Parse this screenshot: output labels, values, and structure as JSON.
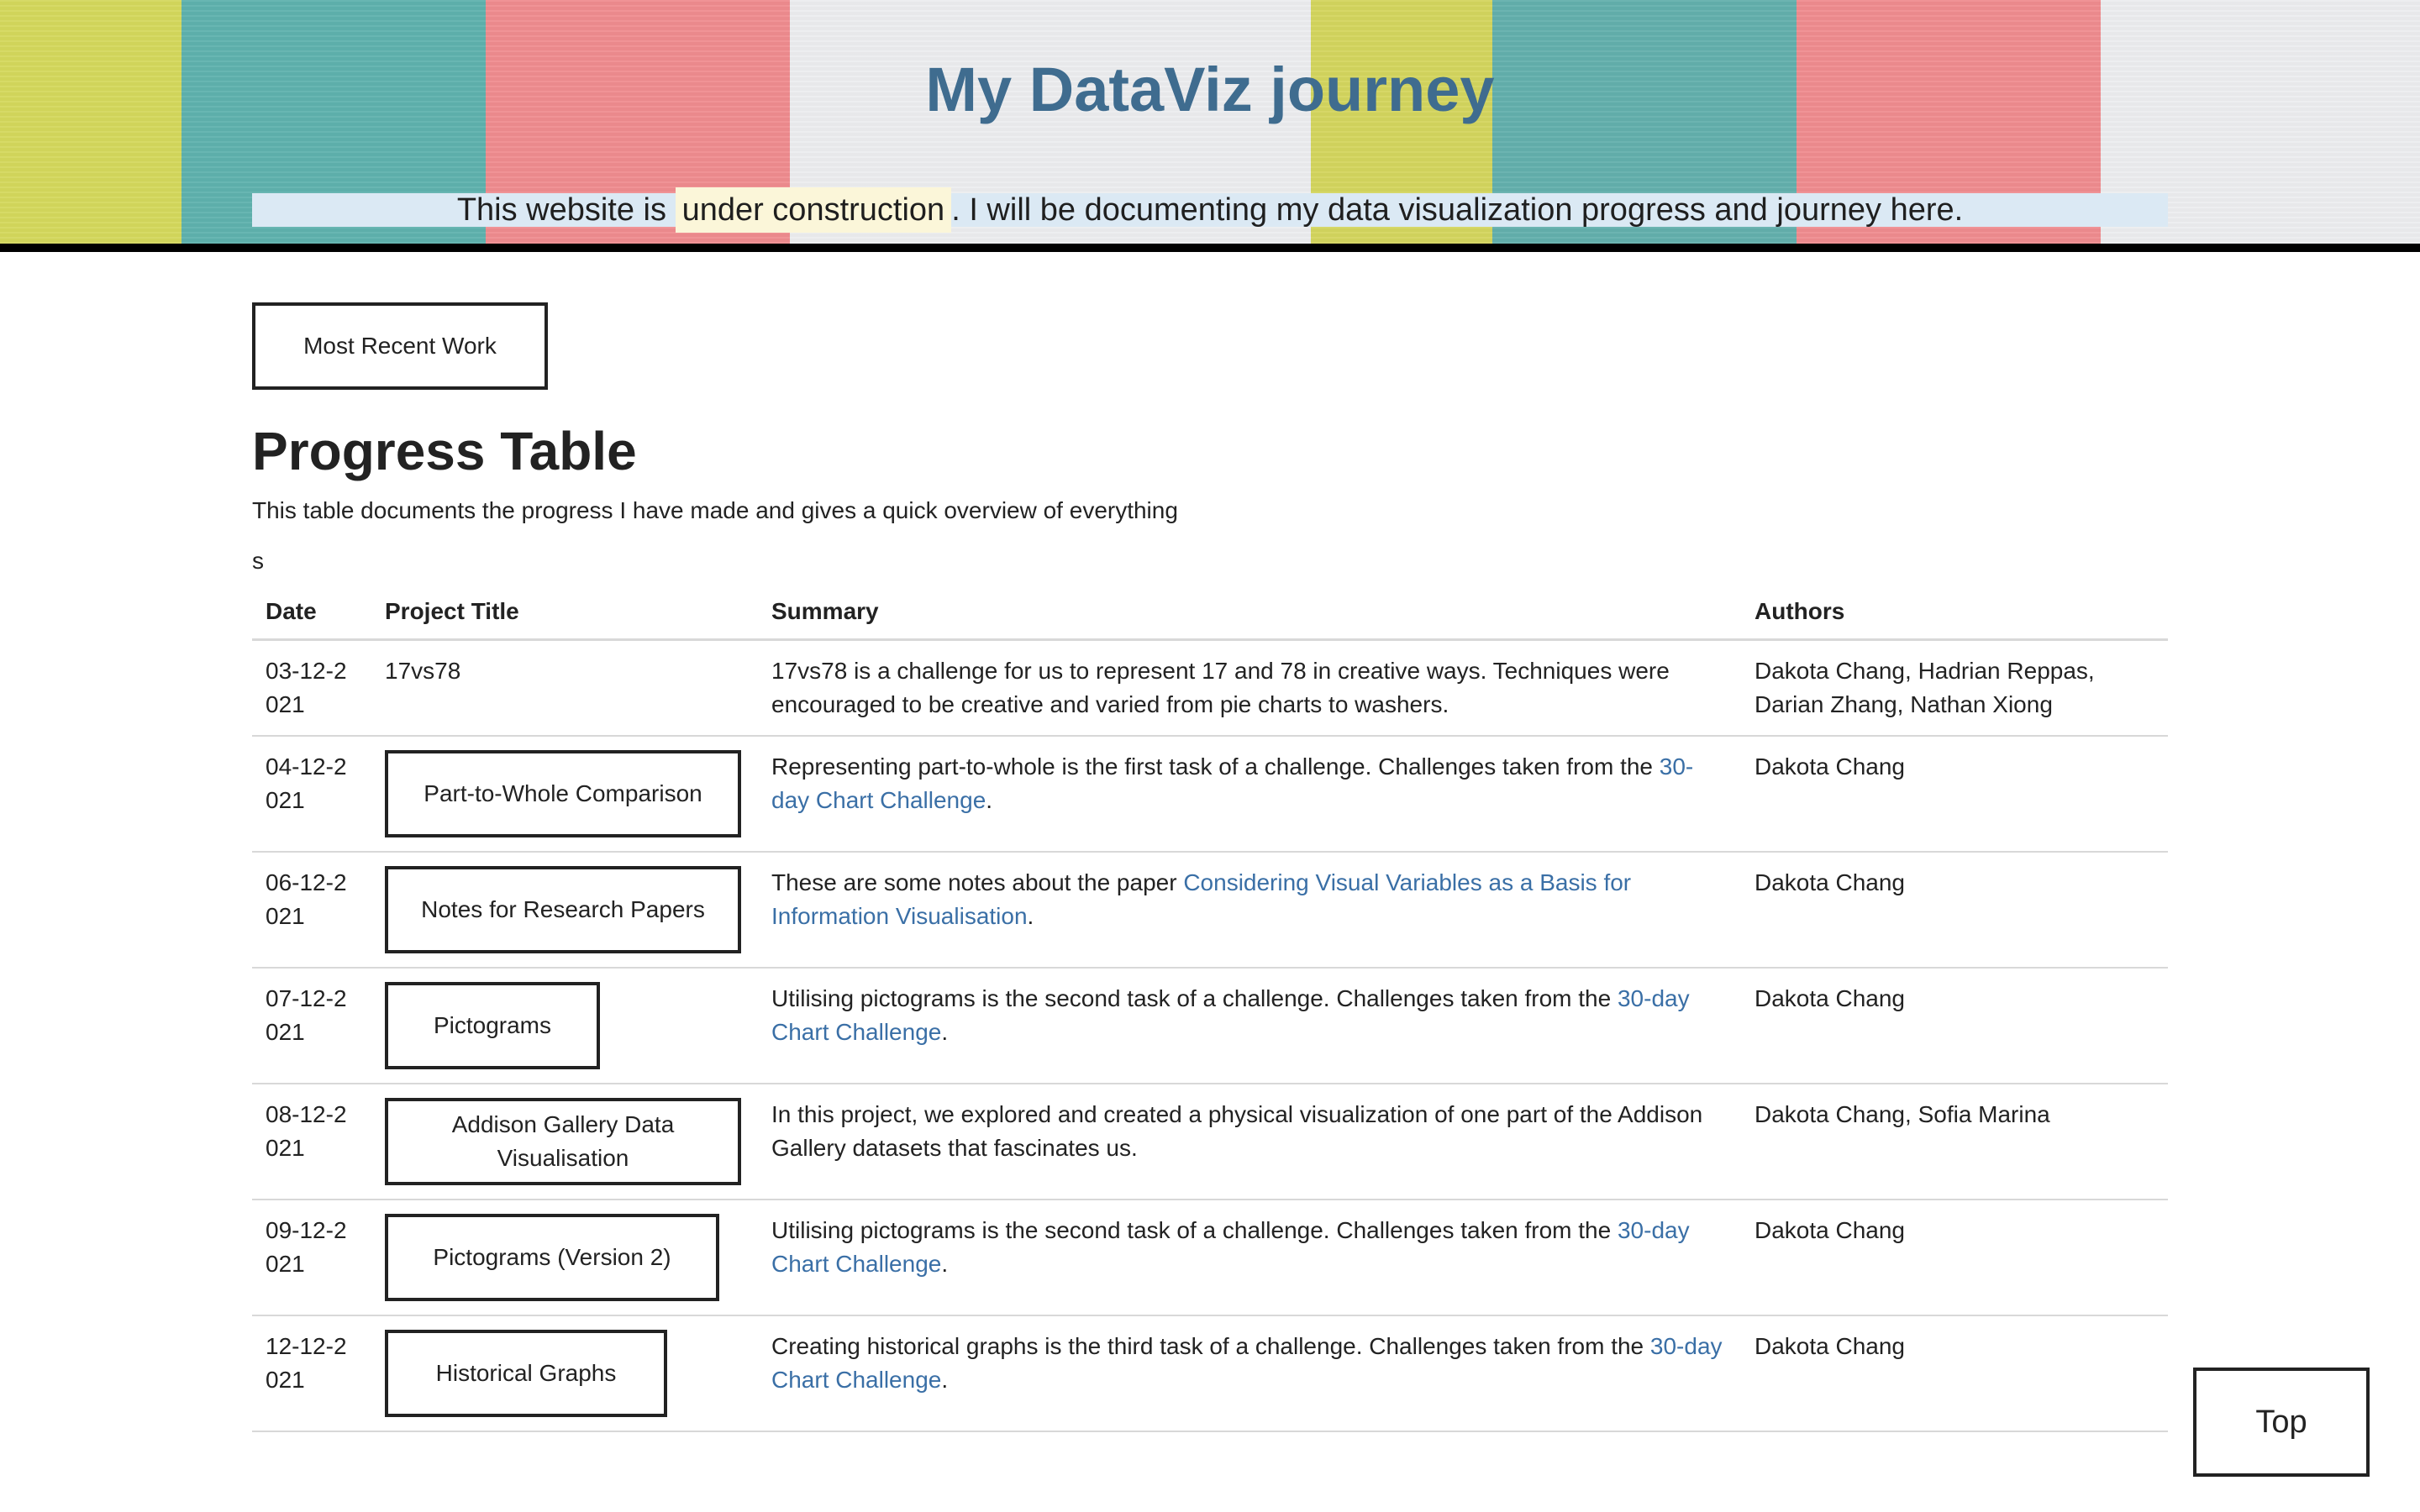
{
  "hero": {
    "title": "My DataViz journey",
    "subtitle_before": "This website is ",
    "subtitle_mark": "under construction",
    "subtitle_after": ". I will be documenting my data visualization progress and journey here."
  },
  "recent_button": "Most Recent Work",
  "section": {
    "title": "Progress Table",
    "description": "This table documents the progress I have made and gives a quick overview of everything",
    "stray": "s"
  },
  "table": {
    "headers": [
      "Date",
      "Project Title",
      "Summary",
      "Authors"
    ],
    "rows": [
      {
        "date": "03-12-2021",
        "title": "17vs78",
        "title_is_button": false,
        "summary_text": "17vs78 is a challenge for us to represent 17 and 78 in creative ways. Techniques were encouraged to be creative and varied from pie charts to washers.",
        "summary_link": "",
        "summary_end": "",
        "authors": "Dakota Chang, Hadrian Reppas, Darian Zhang, Nathan Xiong"
      },
      {
        "date": "04-12-2021",
        "title": "Part-to-Whole Comparison",
        "title_is_button": true,
        "summary_text": "Representing part-to-whole is the first task of a challenge. Challenges taken from the ",
        "summary_link": "30-day Chart Challenge",
        "summary_end": ".",
        "authors": "Dakota Chang"
      },
      {
        "date": "06-12-2021",
        "title": "Notes for Research Papers",
        "title_is_button": true,
        "summary_text": "These are some notes about the paper ",
        "summary_link": "Considering Visual Variables as a Basis for Information Visualisation",
        "summary_end": ".",
        "authors": "Dakota Chang"
      },
      {
        "date": "07-12-2021",
        "title": "Pictograms",
        "title_is_button": true,
        "summary_text": "Utilising pictograms is the second task of a challenge. Challenges taken from the ",
        "summary_link": "30-day Chart Challenge",
        "summary_end": ".",
        "authors": "Dakota Chang"
      },
      {
        "date": "08-12-2021",
        "title": "Addison Gallery Data Visualisation",
        "title_is_button": true,
        "summary_text": "In this project, we explored and created a physical visualization of one part of the Addison Gallery datasets that fascinates us.",
        "summary_link": "",
        "summary_end": "",
        "authors": "Dakota Chang, Sofia Marina"
      },
      {
        "date": "09-12-2021",
        "title": "Pictograms (Version 2)",
        "title_is_button": true,
        "summary_text": "Utilising pictograms is the second task of a challenge. Challenges taken from the ",
        "summary_link": "30-day Chart Challenge",
        "summary_end": ".",
        "authors": "Dakota Chang"
      },
      {
        "date": "12-12-2021",
        "title": "Historical Graphs",
        "title_is_button": true,
        "summary_text": "Creating historical graphs is the third task of a challenge. Challenges taken from the ",
        "summary_link": "30-day Chart Challenge",
        "summary_end": ".",
        "authors": "Dakota Chang"
      }
    ]
  },
  "top_button": "Top",
  "colors": {
    "title": "#3f6c8f",
    "link": "#3a6fa6",
    "subtitle_bg": "#dbe9f4",
    "mark_bg": "#fbf6d9"
  }
}
